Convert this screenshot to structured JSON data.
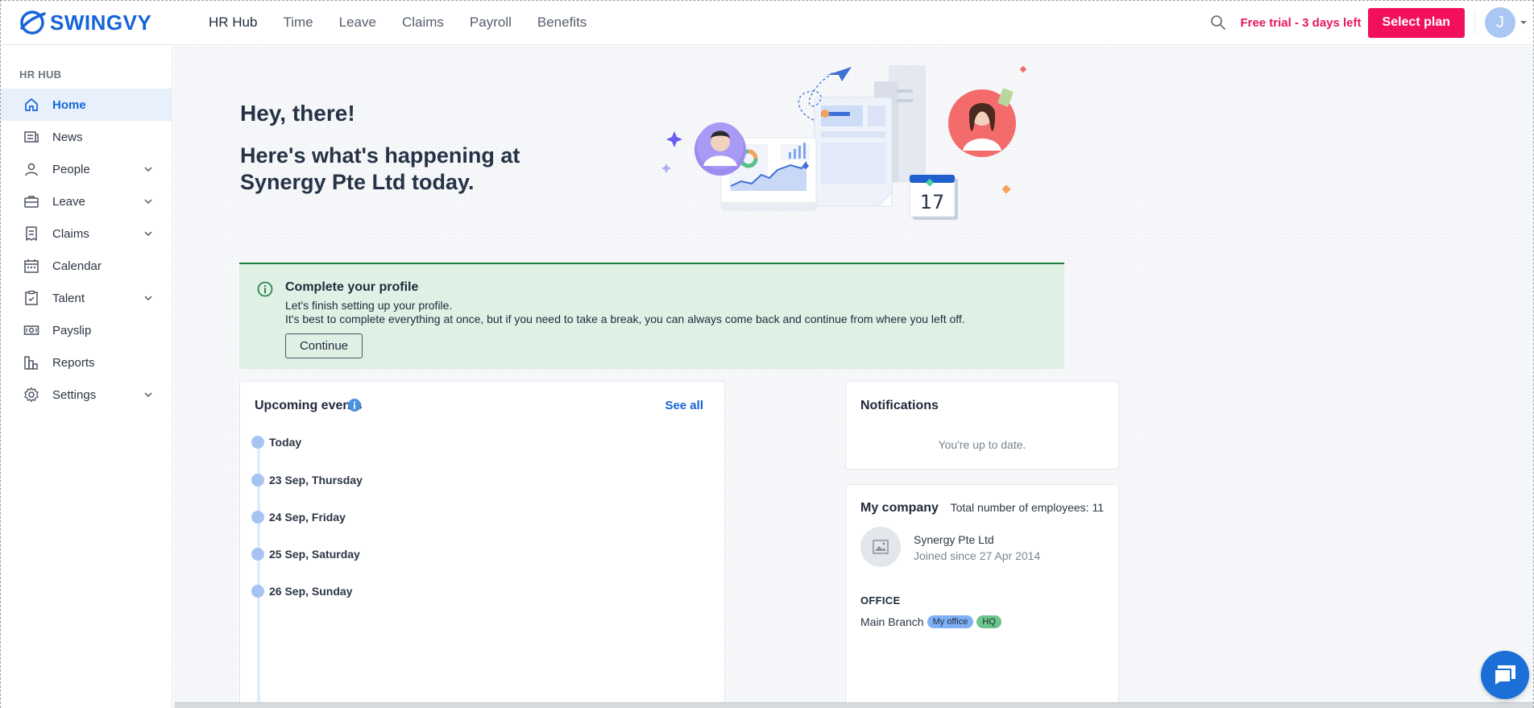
{
  "brand": {
    "name": "SWINGVY",
    "color": "#1565d8"
  },
  "topnav": {
    "items": [
      {
        "label": "HR Hub",
        "active": true
      },
      {
        "label": "Time"
      },
      {
        "label": "Leave"
      },
      {
        "label": "Claims"
      },
      {
        "label": "Payroll"
      },
      {
        "label": "Benefits"
      }
    ],
    "trial_text": "Free trial - 3 days left",
    "select_plan_label": "Select plan",
    "avatar_initial": "J"
  },
  "sidebar": {
    "heading": "HR HUB",
    "items": [
      {
        "label": "Home",
        "icon": "home-icon",
        "active": true
      },
      {
        "label": "News",
        "icon": "news-icon"
      },
      {
        "label": "People",
        "icon": "person-icon",
        "expandable": true
      },
      {
        "label": "Leave",
        "icon": "briefcase-icon",
        "expandable": true
      },
      {
        "label": "Claims",
        "icon": "receipt-icon",
        "expandable": true
      },
      {
        "label": "Calendar",
        "icon": "calendar-icon"
      },
      {
        "label": "Talent",
        "icon": "clipboard-icon",
        "expandable": true
      },
      {
        "label": "Payslip",
        "icon": "money-icon"
      },
      {
        "label": "Reports",
        "icon": "bar-chart-icon"
      },
      {
        "label": "Settings",
        "icon": "gear-icon",
        "expandable": true
      }
    ]
  },
  "main": {
    "greeting": "Hey, there!",
    "subtitle": "Here's what's happening at Synergy Pte Ltd today.",
    "hero_calendar_day": "17",
    "profile_card": {
      "title": "Complete your profile",
      "line1": "Let's finish setting up your profile.",
      "line2": "It's best to complete everything at once, but if you need to take a break, you can always come back and continue from where you left off.",
      "button": "Continue",
      "bg_color": "#dff0e4",
      "accent_color": "#1c7d43"
    },
    "events": {
      "title": "Upcoming events",
      "see_all": "See all",
      "items": [
        {
          "label": "Today"
        },
        {
          "label": "23 Sep, Thursday"
        },
        {
          "label": "24 Sep, Friday"
        },
        {
          "label": "25 Sep, Saturday"
        },
        {
          "label": "26 Sep, Sunday"
        }
      ]
    },
    "notifications": {
      "title": "Notifications",
      "empty_text": "You're up to date."
    },
    "company": {
      "title": "My company",
      "employee_count": "Total number of employees: 11",
      "name": "Synergy Pte Ltd",
      "joined": "Joined since 27 Apr 2014",
      "office_heading": "OFFICE",
      "branch": {
        "name": "Main Branch",
        "badges": [
          "My office",
          "HQ"
        ]
      }
    }
  },
  "colors": {
    "trial": "#e8175d",
    "select_plan_bg": "#f2105d",
    "link": "#1565d8",
    "active_bg": "#e8f0fc"
  }
}
